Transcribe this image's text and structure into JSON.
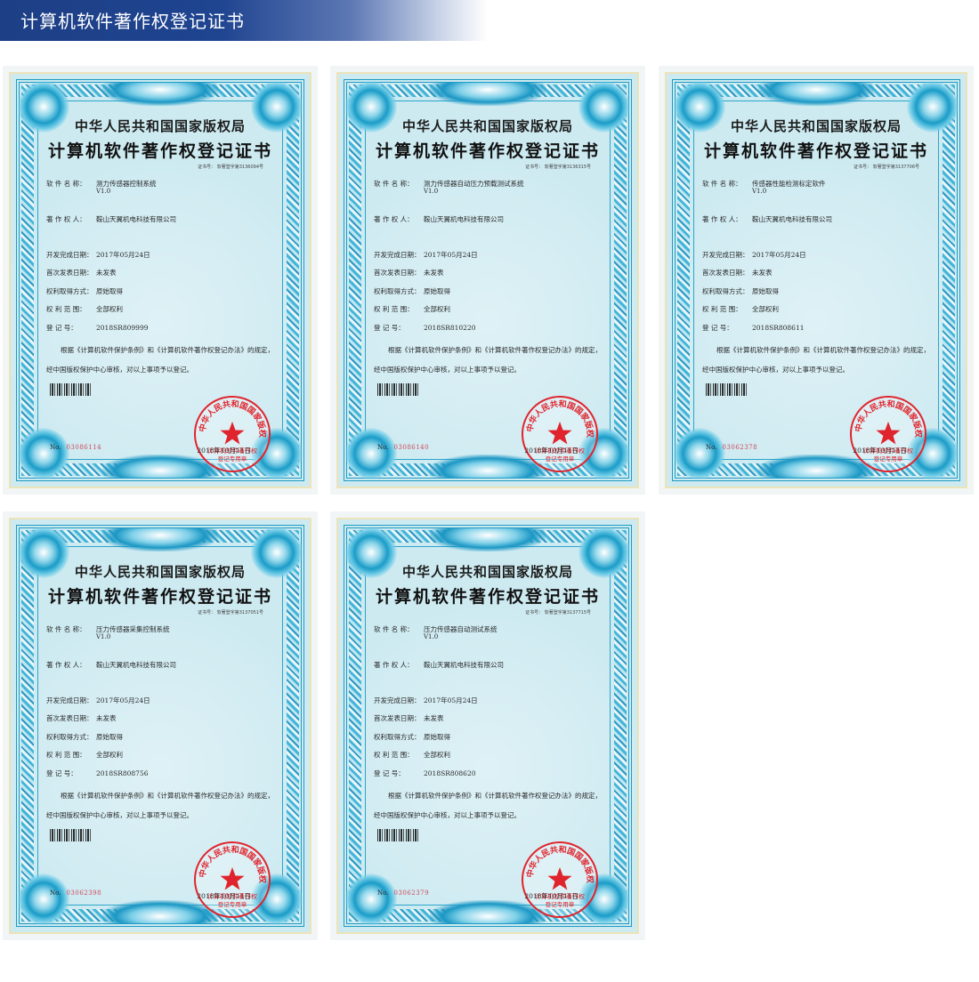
{
  "header": {
    "title": "计算机软件著作权登记证书"
  },
  "certificate_template": {
    "authority": "中华人民共和国国家版权局",
    "title": "计算机软件著作权登记证书",
    "labels": {
      "software": "软 件 名 称：",
      "owner": "著 作 权 人：",
      "completion": "开发完成日期：",
      "publication": "首次发表日期：",
      "acquisition": "权利取得方式：",
      "scope": "权 利 范 围：",
      "registration": "登    记    号："
    },
    "body_text": "根据《计算机软件保护条例》和《计算机软件著作权登记办法》的规定，经中国版权保护中心审核，对以上事项予以登记。",
    "no_label": "No.",
    "issue_date": "2018年10月11日"
  },
  "certificates": [
    {
      "cert_no": "证书号： 软著登字第3136094号",
      "software_name": "测力传感器控制系统",
      "version": "V1.0",
      "owner": "鞍山天翼机电科技有限公司",
      "completion_date": "2017年05月24日",
      "publication_date": "未发表",
      "acquisition": "原始取得",
      "scope": "全部权利",
      "registration_no": "2018SR809999",
      "serial": "03086114"
    },
    {
      "cert_no": "证书号： 软著登字第3136315号",
      "software_name": "测力传感器自动压力预载测试系统",
      "version": "V1.0",
      "owner": "鞍山天翼机电科技有限公司",
      "completion_date": "2017年05月24日",
      "publication_date": "未发表",
      "acquisition": "原始取得",
      "scope": "全部权利",
      "registration_no": "2018SR810220",
      "serial": "03086140"
    },
    {
      "cert_no": "证书号： 软著登字第3137706号",
      "software_name": "传感器性能检测标定软件",
      "version": "V1.0",
      "owner": "鞍山天翼机电科技有限公司",
      "completion_date": "2017年05月24日",
      "publication_date": "未发表",
      "acquisition": "原始取得",
      "scope": "全部权利",
      "registration_no": "2018SR808611",
      "serial": "03062378"
    },
    {
      "cert_no": "证书号： 软著登字第3137051号",
      "software_name": "压力传感器采集控制系统",
      "version": "V1.0",
      "owner": "鞍山天翼机电科技有限公司",
      "completion_date": "2017年05月24日",
      "publication_date": "未发表",
      "acquisition": "原始取得",
      "scope": "全部权利",
      "registration_no": "2018SR808756",
      "serial": "03062398"
    },
    {
      "cert_no": "证书号： 软著登字第3137715号",
      "software_name": "压力传感器自动测试系统",
      "version": "V1.0",
      "owner": "鞍山天翼机电科技有限公司",
      "completion_date": "2017年05月24日",
      "publication_date": "未发表",
      "acquisition": "原始取得",
      "scope": "全部权利",
      "registration_no": "2018SR808620",
      "serial": "03062379"
    }
  ],
  "seal": {
    "outer_text": "中华人民共和国国家版权局",
    "inner_line_1": "计算机软件著作权",
    "inner_line_2": "登记专用章",
    "color": "#e0242d"
  },
  "colors": {
    "banner": "#1f4490",
    "paper": "#cdeaf1",
    "frame": "#1f9bc3",
    "serial": "#d2485a"
  }
}
